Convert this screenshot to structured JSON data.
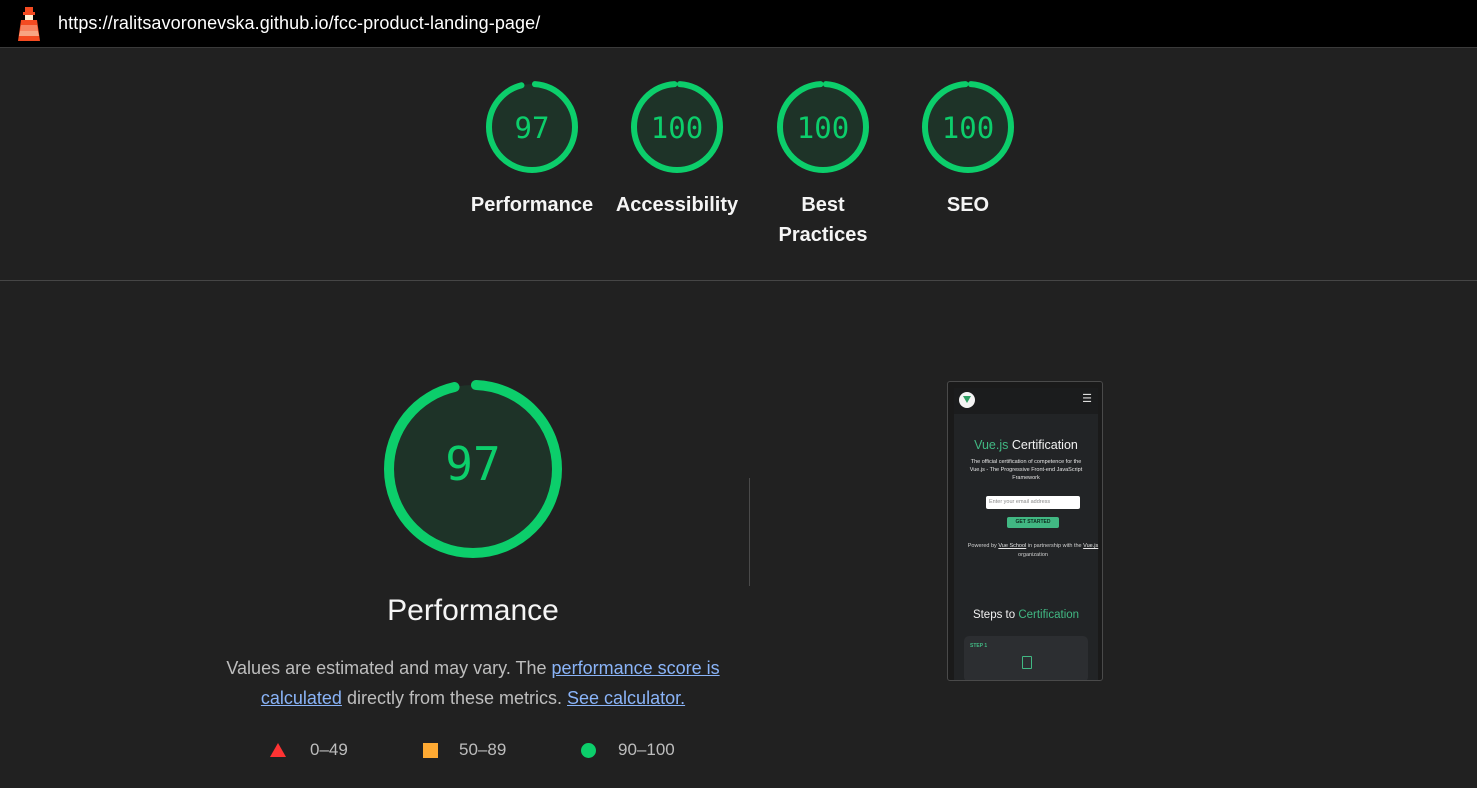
{
  "header": {
    "url": "https://ralitsavoronevska.github.io/fcc-product-landing-page/",
    "logo_icon": "lighthouse-icon"
  },
  "summary": {
    "gauges": [
      {
        "score": "97",
        "label": "Performance",
        "value": 97
      },
      {
        "score": "100",
        "label": "Accessibility",
        "value": 100
      },
      {
        "score": "100",
        "label": "Best Practices",
        "value": 100
      },
      {
        "score": "100",
        "label": "SEO",
        "value": 100
      }
    ],
    "pass_color": "#0cce6b"
  },
  "performance": {
    "score": "97",
    "value": 97,
    "title": "Performance",
    "desc_prefix": "Values are estimated and may vary. The ",
    "desc_link1": "performance score is calculated",
    "desc_middle": " directly from these metrics. ",
    "desc_link2": "See calculator."
  },
  "legend": [
    {
      "range": "0–49",
      "icon": "red-triangle-icon",
      "color": "#ff3333"
    },
    {
      "range": "50–89",
      "icon": "orange-square-icon",
      "color": "#ffaa33"
    },
    {
      "range": "90–100",
      "icon": "green-circle-icon",
      "color": "#0cce6b"
    }
  ],
  "screenshot": {
    "menu_icon": "hamburger-icon",
    "title_green": "Vue.js",
    "title_rest": " Certification",
    "subtitle": "The official certification of competence for the Vue.js - The Progressive Front-end JavaScript Framework",
    "email_placeholder": "Enter your email address",
    "button": "GET STARTED",
    "powered_prefix": "Powered by ",
    "powered_link1": "Vue School",
    "powered_middle": " in partnership with the ",
    "powered_link2": "Vue.js",
    "powered_suffix": " organization",
    "steps_prefix": "Steps to ",
    "steps_green": "Certification",
    "step_label": "STEP 1"
  }
}
